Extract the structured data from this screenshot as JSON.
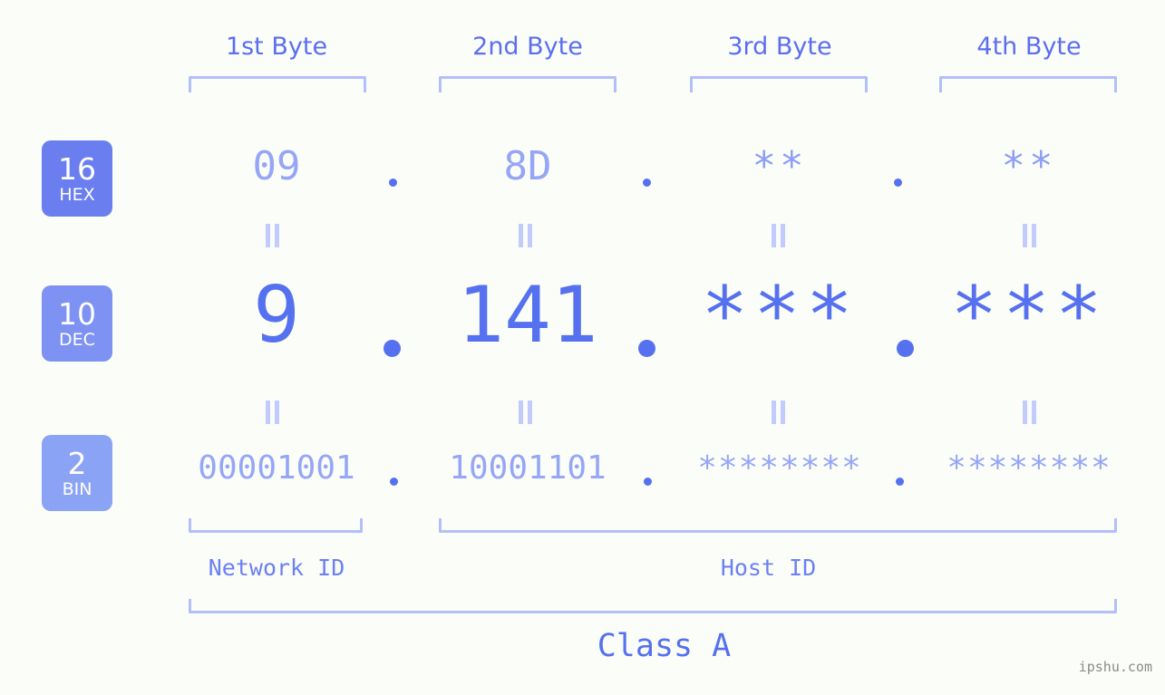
{
  "colors": {
    "background": "#fbfdf8",
    "accent_strong": "#5671ef",
    "accent_mid": "#6c80f2",
    "accent_light": "#96a6f7",
    "bracket": "#b3bffa",
    "badge_hex": "#6a7ef0",
    "badge_dec": "#7d92f3",
    "badge_bin": "#8ba3f5",
    "watermark": "#8c8c8c"
  },
  "byte_headers": [
    {
      "label": "1st Byte"
    },
    {
      "label": "2nd Byte"
    },
    {
      "label": "3rd Byte"
    },
    {
      "label": "4th Byte"
    }
  ],
  "radix_badges": [
    {
      "number": "16",
      "label": "HEX"
    },
    {
      "number": "10",
      "label": "DEC"
    },
    {
      "number": "2",
      "label": "BIN"
    }
  ],
  "rows": {
    "hex": {
      "radix": "16",
      "name": "HEX",
      "values": [
        "09",
        "8D",
        "**",
        "**"
      ],
      "separator": "."
    },
    "dec": {
      "radix": "10",
      "name": "DEC",
      "values": [
        "9",
        "141",
        "***",
        "***"
      ],
      "separator": "."
    },
    "bin": {
      "radix": "2",
      "name": "BIN",
      "values": [
        "00001001",
        "10001101",
        "********",
        "********"
      ],
      "separator": "."
    }
  },
  "equality_symbol": "||",
  "sections": {
    "network_id": "Network ID",
    "host_id": "Host ID",
    "class": "Class A"
  },
  "watermark": "ipshu.com"
}
